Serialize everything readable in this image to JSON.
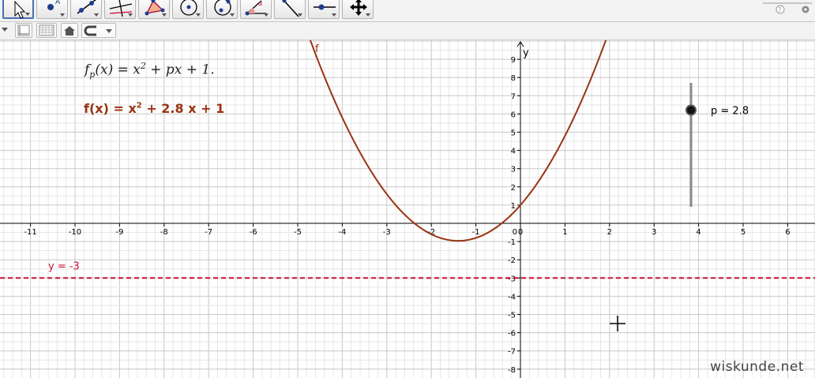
{
  "colors": {
    "curve": "#993311",
    "line": "#cc1133",
    "grid_minor": "#e6e6e6",
    "grid_major": "#c8c8c8",
    "axis": "#000000",
    "slider": "#8a8a8a"
  },
  "toolbar": {
    "tools": [
      {
        "name": "move-tool",
        "icon": "arrow-cursor-icon",
        "active": true
      },
      {
        "name": "point-tool",
        "icon": "point-icon"
      },
      {
        "name": "line-tool",
        "icon": "line-through-points-icon"
      },
      {
        "name": "perpendicular-line-tool",
        "icon": "perpendicular-lines-icon"
      },
      {
        "name": "polygon-tool",
        "icon": "polygon-icon"
      },
      {
        "name": "circle-tool",
        "icon": "circle-center-point-icon"
      },
      {
        "name": "circle-through-points-tool",
        "icon": "circle-through-points-icon"
      },
      {
        "name": "angle-tool",
        "icon": "angle-icon"
      },
      {
        "name": "reflect-tool",
        "icon": "reflect-line-icon"
      },
      {
        "name": "slider-tool",
        "icon": "slider-icon"
      },
      {
        "name": "move-graphics-view-tool",
        "icon": "move-arrows-icon"
      }
    ]
  },
  "graph": {
    "formula_template": {
      "f": "f",
      "sub": "p",
      "mid": "(x) = x",
      "exp": "2",
      "rest": " + px + 1."
    },
    "function_label": "f",
    "function_definition": {
      "lhs": "f(x)  =  x",
      "exp": "2",
      "rest": " + 2.8 x + 1"
    },
    "line_label": "y = -3",
    "slider_label": "p = 2.8",
    "watermark": "wiskunde.net"
  },
  "chart_data": {
    "type": "line",
    "xlabel": "",
    "ylabel": "y",
    "xlim": [
      -11.6,
      6.7
    ],
    "ylim": [
      -8.5,
      10
    ],
    "x_ticks": [
      -11,
      -10,
      -9,
      -8,
      -7,
      -6,
      -5,
      -4,
      -3,
      -2,
      -1,
      0,
      1,
      2,
      3,
      4,
      5,
      6
    ],
    "y_ticks": [
      -8,
      -7,
      -6,
      -5,
      -4,
      -3,
      -2,
      -1,
      1,
      2,
      3,
      4,
      5,
      6,
      7,
      8,
      9
    ],
    "grid": true,
    "series": [
      {
        "name": "f",
        "expression": "x^2 + 2.8x + 1",
        "coefficients": [
          1,
          2.8,
          1
        ]
      },
      {
        "name": "y = -3",
        "constant": -3,
        "style": "dashed"
      }
    ],
    "slider": {
      "name": "p",
      "value": 2.8,
      "min": -5,
      "max": 5
    }
  }
}
